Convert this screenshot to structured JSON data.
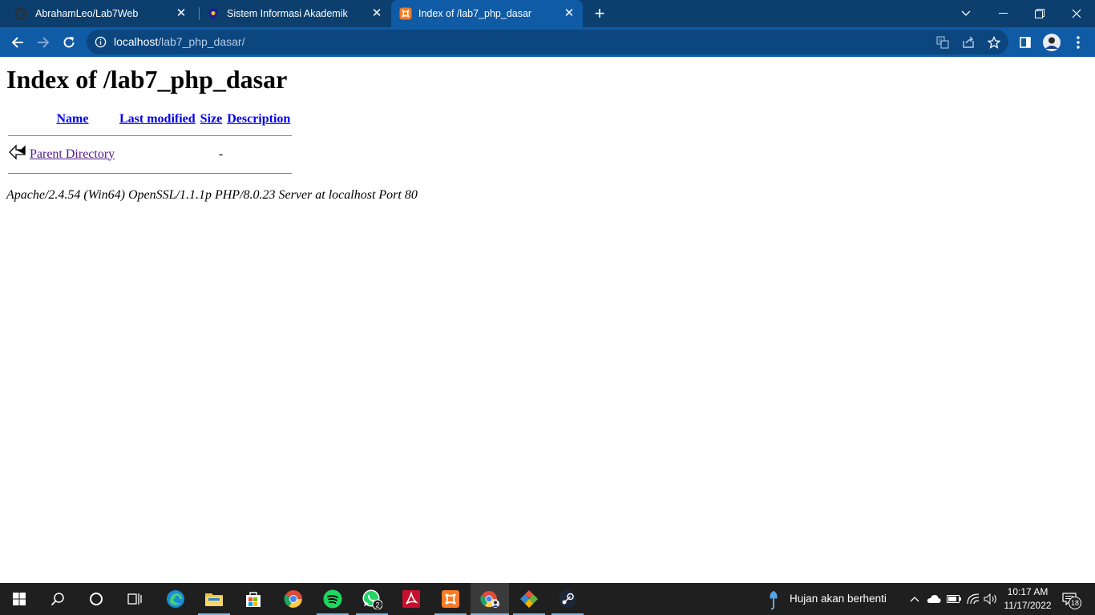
{
  "browser": {
    "tabs": [
      {
        "title": "AbrahamLeo/Lab7Web",
        "favicon": "github-icon",
        "active": false
      },
      {
        "title": "Sistem Informasi Akademik",
        "favicon": "academic-shield-icon",
        "active": false
      },
      {
        "title": "Index of /lab7_php_dasar",
        "favicon": "xampp-icon",
        "active": true
      }
    ],
    "close_glyph": "✕",
    "new_tab_glyph": "+",
    "address": {
      "host": "localhost",
      "path": "/lab7_php_dasar/"
    },
    "toolbar_icons": [
      "back-icon",
      "forward-icon",
      "reload-icon",
      "translate-icon",
      "share-icon",
      "bookmark-star-icon",
      "side-panel-icon",
      "profile-avatar",
      "menu-icon"
    ],
    "accent_color": "#0f5ba6",
    "tabstrip_color": "#0c3f6e"
  },
  "page": {
    "heading": "Index of /lab7_php_dasar",
    "columns": {
      "name": "Name",
      "last_modified": "Last modified",
      "size": "Size",
      "description": "Description"
    },
    "rows": [
      {
        "name": "Parent Directory",
        "last_modified": "",
        "size": "-",
        "description": "",
        "icon": "back-arrow-icon"
      }
    ],
    "server_signature": "Apache/2.4.54 (Win64) OpenSSL/1.1.1p PHP/8.0.23 Server at localhost Port 80",
    "link_color": "#0000ee",
    "visited_link_color": "#551a8b"
  },
  "taskbar": {
    "apps": [
      "start-icon",
      "search-icon",
      "cortana-icon",
      "task-view-icon",
      "edge-icon",
      "file-explorer-icon",
      "store-icon",
      "chrome-icon",
      "spotify-icon",
      "whatsapp-icon",
      "acrobat-icon",
      "xampp-icon",
      "chrome-profile-icon",
      "git-icon",
      "steam-icon"
    ],
    "whatsapp_badge": "2",
    "weather_text": "Hujan akan berhenti",
    "time": "10:17 AM",
    "date": "11/17/2022",
    "notification_count": "18"
  }
}
